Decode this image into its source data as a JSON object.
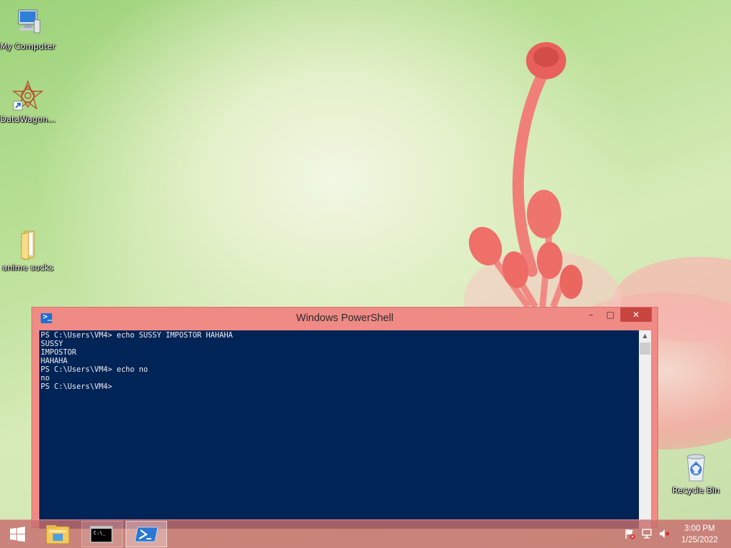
{
  "desktop": {
    "icons": [
      {
        "label": "My Computer",
        "icon": "computer-icon"
      },
      {
        "label": "DataWagon...",
        "icon": "datawagon-shortcut-icon"
      },
      {
        "label": "anime sucks",
        "icon": "folder-icon"
      },
      {
        "label": "Recycle Bin",
        "icon": "recycle-bin-icon"
      }
    ]
  },
  "window": {
    "title": "Windows PowerShell",
    "icon": "powershell-icon",
    "controls": {
      "minimize": "–",
      "maximize": "□",
      "close": "✕"
    },
    "console_lines": [
      "PS C:\\Users\\VM4> echo SUSSY IMPOSTOR HAHAHA",
      "SUSSY",
      "IMPOSTOR",
      "HAHAHA",
      "PS C:\\Users\\VM4> echo no",
      "no",
      "PS C:\\Users\\VM4>"
    ],
    "colors": {
      "console_bg": "#012456",
      "console_fg": "#eeedf0",
      "frame": "#f08a85",
      "close_btn": "#c9453f"
    }
  },
  "taskbar": {
    "start": "windows-logo-icon",
    "items": [
      {
        "name": "File Explorer",
        "icon": "file-explorer-icon"
      },
      {
        "name": "Command Prompt",
        "icon": "cmd-icon",
        "glyph": "C:\\_"
      },
      {
        "name": "Windows PowerShell",
        "icon": "powershell-icon",
        "active": true
      }
    ],
    "tray": [
      "action-center-flag-icon",
      "network-icon",
      "volume-muted-icon"
    ],
    "clock": {
      "time": "3:00 PM",
      "date": "1/25/2022"
    }
  }
}
